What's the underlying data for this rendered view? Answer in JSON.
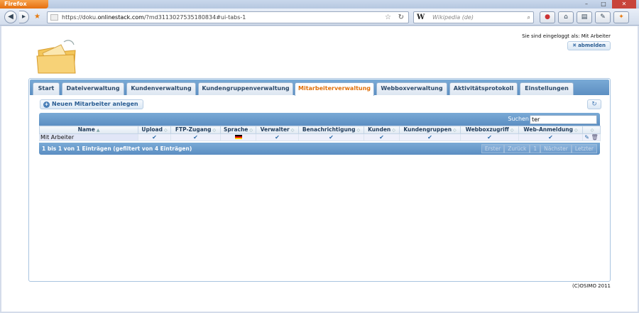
{
  "browser": {
    "app_button": "Firefox",
    "window_controls": [
      "–",
      "□",
      "✕"
    ],
    "url": "https://doku.onlinestack.com/?md3113027535180834 4#ui-tabs-1",
    "url_prefix": "https://doku.",
    "url_host": "onlinestack.com",
    "url_path": "/?md3113027535180834#ui-tabs-1",
    "search_engine_glyph": "W",
    "search_placeholder": "Wikipedia (de)",
    "toolbar_icons": [
      "adblock-icon",
      "home-icon",
      "bookmarks-icon",
      "pen-icon",
      "addon-icon"
    ]
  },
  "header": {
    "login_text": "Sie sind eingeloggt als: Mit Arbeiter",
    "logout_label": "abmelden"
  },
  "tabs": [
    {
      "label": "Start",
      "active": false
    },
    {
      "label": "Dateiverwaltung",
      "active": false
    },
    {
      "label": "Kundenverwaltung",
      "active": false
    },
    {
      "label": "Kundengruppenverwaltung",
      "active": false
    },
    {
      "label": "Mitarbeiterverwaltung",
      "active": true
    },
    {
      "label": "Webboxverwaltung",
      "active": false
    },
    {
      "label": "Aktivitätsprotokoll",
      "active": false
    },
    {
      "label": "Einstellungen",
      "active": false
    }
  ],
  "actions": {
    "new_label": "Neuen Mitarbeiter anlegen"
  },
  "table": {
    "search_label": "Suchen",
    "search_value": "ter",
    "columns": [
      "Name",
      "Upload",
      "FTP-Zugang",
      "Sprache",
      "Verwalter",
      "Benachrichtigung",
      "Kunden",
      "Kundengruppen",
      "Webboxzugriff",
      "Web-Anmeldung",
      ""
    ],
    "rows": [
      {
        "name": "Mit Arbeiter",
        "upload": "✔",
        "ftp": "✔",
        "language": "de",
        "admin": "✔",
        "notify": "✔",
        "customers": "✔",
        "customer_groups": "✔",
        "webbox": "✔",
        "web_login": "✔"
      }
    ],
    "info": "1 bis 1 von 1 Einträgen (gefiltert von 4 Einträgen)",
    "pager": [
      "Erster",
      "Zurück",
      "1",
      "Nächster",
      "Letzter"
    ]
  },
  "footer": {
    "copyright": "(C)OSIMO 2011"
  }
}
